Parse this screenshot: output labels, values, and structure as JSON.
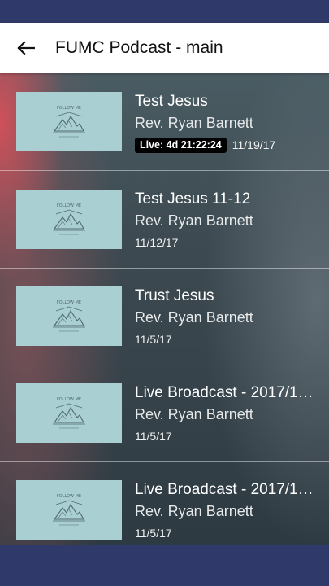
{
  "app_bar": {
    "title": "FUMC Podcast - main"
  },
  "episodes": [
    {
      "title": "Test Jesus",
      "author": "Rev. Ryan Barnett",
      "live_label": "Live: 4d 21:22:24",
      "date": "11/19/17",
      "thumbnail_text": "FOLLOW ME"
    },
    {
      "title": "Test Jesus 11-12",
      "author": "Rev. Ryan Barnett",
      "date": "11/12/17",
      "thumbnail_text": "FOLLOW ME"
    },
    {
      "title": "Trust Jesus",
      "author": "Rev. Ryan Barnett",
      "date": "11/5/17",
      "thumbnail_text": "FOLLOW ME"
    },
    {
      "title": "Live Broadcast - 2017/1…",
      "author": "Rev. Ryan Barnett",
      "date": "11/5/17",
      "thumbnail_text": "FOLLOW ME"
    },
    {
      "title": "Live Broadcast - 2017/1…",
      "author": "Rev. Ryan Barnett",
      "date": "11/5/17",
      "thumbnail_text": "FOLLOW ME"
    }
  ],
  "colors": {
    "status_bar": "#303a6a",
    "nav_bar": "#303a6a",
    "app_bar": "#ffffff",
    "thumbnail_bg": "#a9cfd2",
    "live_badge_bg": "#000000"
  },
  "icons": {
    "back": "arrow-left-icon",
    "thumbnail_logo": "mountain-logo-icon"
  }
}
